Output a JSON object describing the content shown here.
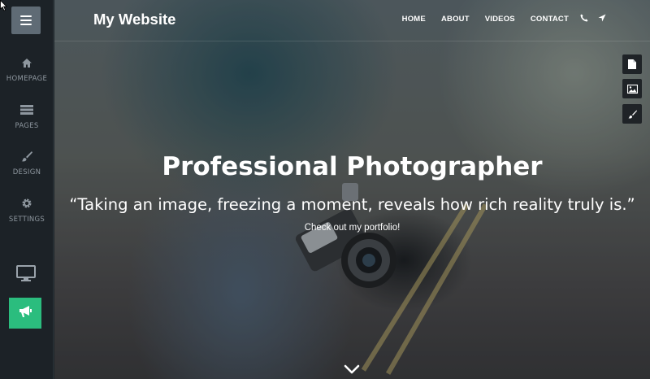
{
  "sidebar": {
    "items": [
      {
        "label": "HOMEPAGE",
        "icon": "home-icon"
      },
      {
        "label": "PAGES",
        "icon": "pages-icon"
      },
      {
        "label": "DESIGN",
        "icon": "brush-icon"
      },
      {
        "label": "SETTINGS",
        "icon": "gear-icon"
      }
    ],
    "bottom_icons": [
      "monitor-icon",
      "megaphone-icon"
    ],
    "accent_color": "#2bbd7e"
  },
  "navbar": {
    "brand": "My Website",
    "links": [
      "HOME",
      "ABOUT",
      "VIDEOS",
      "CONTACT"
    ],
    "icons": [
      "phone-icon",
      "location-arrow-icon"
    ]
  },
  "tools": [
    "file-icon",
    "image-icon",
    "brush-icon"
  ],
  "hero": {
    "title": "Professional Photographer",
    "quote": "“Taking an image, freezing a moment, reveals how rich reality truly is.”",
    "cta": "Check out my portfolio!",
    "scroll_icon": "chevron-down-icon"
  }
}
